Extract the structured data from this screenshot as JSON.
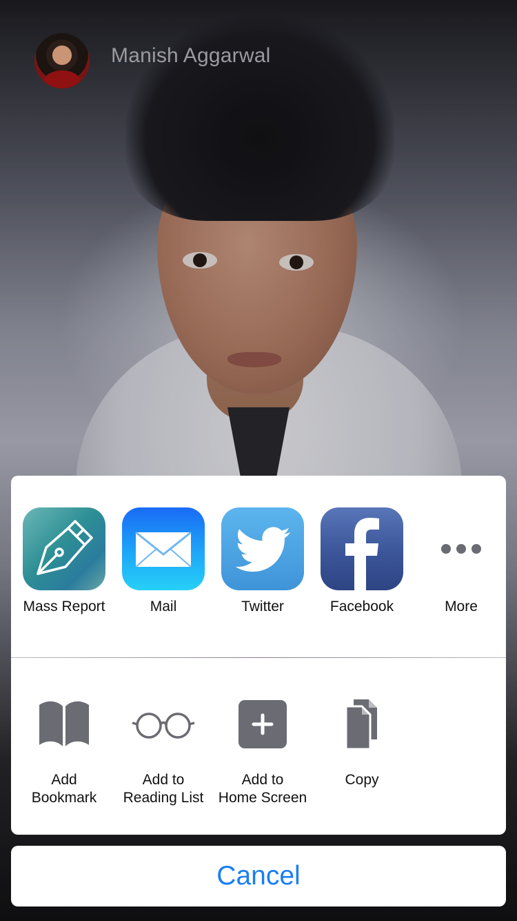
{
  "header": {
    "author_name": "Manish Aggarwal"
  },
  "share_sheet": {
    "apps": [
      {
        "label": "Mass Report",
        "icon": "pen-nib-icon"
      },
      {
        "label": "Mail",
        "icon": "envelope-icon"
      },
      {
        "label": "Twitter",
        "icon": "twitter-bird-icon"
      },
      {
        "label": "Facebook",
        "icon": "facebook-f-icon"
      },
      {
        "label": "More",
        "icon": "more-dots-icon"
      }
    ],
    "actions": [
      {
        "label_line1": "Add",
        "label_line2": "Bookmark",
        "icon": "book-icon"
      },
      {
        "label_line1": "Add to",
        "label_line2": "Reading List",
        "icon": "glasses-icon"
      },
      {
        "label_line1": "Add to",
        "label_line2": "Home Screen",
        "icon": "plus-square-icon"
      },
      {
        "label_line1": "Copy",
        "label_line2": "",
        "icon": "copy-documents-icon"
      }
    ],
    "cancel_label": "Cancel"
  },
  "colors": {
    "accent": "#1a7ef4",
    "action_icon_gray": "#6b6b73",
    "sheet_background": "#ffffff"
  }
}
